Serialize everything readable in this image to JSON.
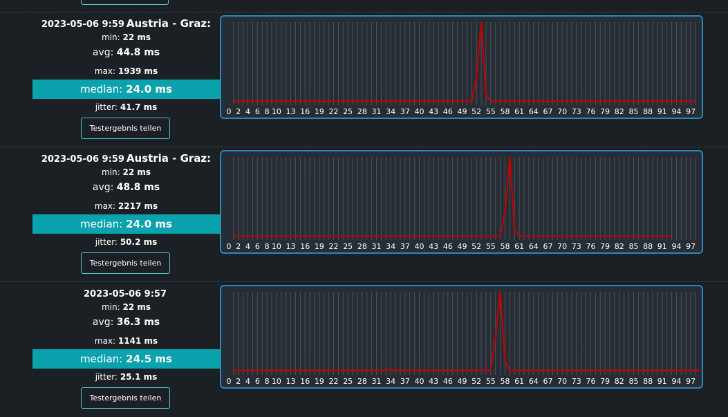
{
  "share_label": "Testergebnis teilen",
  "colors": {
    "accent": "#0aa2ad",
    "line": "#c40000",
    "chart_border": "#2b86bf",
    "background": "#1b2024"
  },
  "tests": [
    {
      "datetime": "2023-05-06 9:59",
      "location": "Austria - Graz:",
      "min": "22 ms",
      "avg": "44.8 ms",
      "max": "1939 ms",
      "median": "24.0 ms",
      "jitter": "41.7 ms",
      "min_label": "min:",
      "avg_label": "avg:",
      "max_label": "max:",
      "median_label": "median:",
      "jitter_label": "jitter:"
    },
    {
      "datetime": "2023-05-06 9:59",
      "location": "Austria - Graz:",
      "min": "22 ms",
      "avg": "48.8 ms",
      "max": "2217 ms",
      "median": "24.0 ms",
      "jitter": "50.2 ms",
      "min_label": "min:",
      "avg_label": "avg:",
      "max_label": "max:",
      "median_label": "median:",
      "jitter_label": "jitter:"
    },
    {
      "datetime": "2023-05-06 9:57",
      "location": "",
      "min": "22 ms",
      "avg": "36.3 ms",
      "max": "1141 ms",
      "median": "24.5 ms",
      "jitter": "25.1 ms",
      "min_label": "min:",
      "avg_label": "avg:",
      "max_label": "max:",
      "median_label": "median:",
      "jitter_label": "jitter:"
    }
  ],
  "chart_data": [
    {
      "type": "line",
      "x_ticks": [
        "0",
        "2",
        "4",
        "6",
        "8",
        "10",
        "13",
        "16",
        "19",
        "22",
        "25",
        "28",
        "31",
        "34",
        "37",
        "40",
        "43",
        "46",
        "49",
        "52",
        "55",
        "58",
        "61",
        "64",
        "67",
        "70",
        "73",
        "76",
        "79",
        "82",
        "85",
        "88",
        "91",
        "94",
        "97"
      ],
      "x_range": [
        0,
        98
      ],
      "count": 98,
      "baseline": 24,
      "spikes": [
        [
          52,
          600
        ],
        [
          53,
          1939
        ],
        [
          54,
          200
        ]
      ],
      "ylim": [
        0,
        1939
      ],
      "grid": true
    },
    {
      "type": "line",
      "x_ticks": [
        "0",
        "2",
        "4",
        "6",
        "8",
        "10",
        "13",
        "16",
        "19",
        "22",
        "25",
        "28",
        "31",
        "34",
        "37",
        "40",
        "43",
        "46",
        "49",
        "52",
        "55",
        "58",
        "61",
        "64",
        "67",
        "70",
        "73",
        "76",
        "79",
        "82",
        "85",
        "88",
        "91",
        "94",
        "97"
      ],
      "x_range": [
        0,
        98
      ],
      "count": 93,
      "baseline": 24,
      "spikes": [
        [
          58,
          700
        ],
        [
          59,
          2217
        ],
        [
          60,
          200
        ]
      ],
      "ylim": [
        0,
        2217
      ],
      "grid": true
    },
    {
      "type": "line",
      "x_ticks": [
        "0",
        "2",
        "4",
        "6",
        "8",
        "10",
        "13",
        "16",
        "19",
        "22",
        "25",
        "28",
        "31",
        "34",
        "37",
        "40",
        "43",
        "46",
        "49",
        "52",
        "55",
        "58",
        "61",
        "64",
        "67",
        "70",
        "73",
        "76",
        "79",
        "82",
        "85",
        "88",
        "91",
        "94",
        "97"
      ],
      "x_range": [
        0,
        98
      ],
      "count": 99,
      "baseline": 24,
      "spikes": [
        [
          34,
          40
        ],
        [
          56,
          500
        ],
        [
          57,
          1141
        ],
        [
          58,
          150
        ]
      ],
      "ylim": [
        0,
        1141
      ],
      "grid": true
    }
  ]
}
